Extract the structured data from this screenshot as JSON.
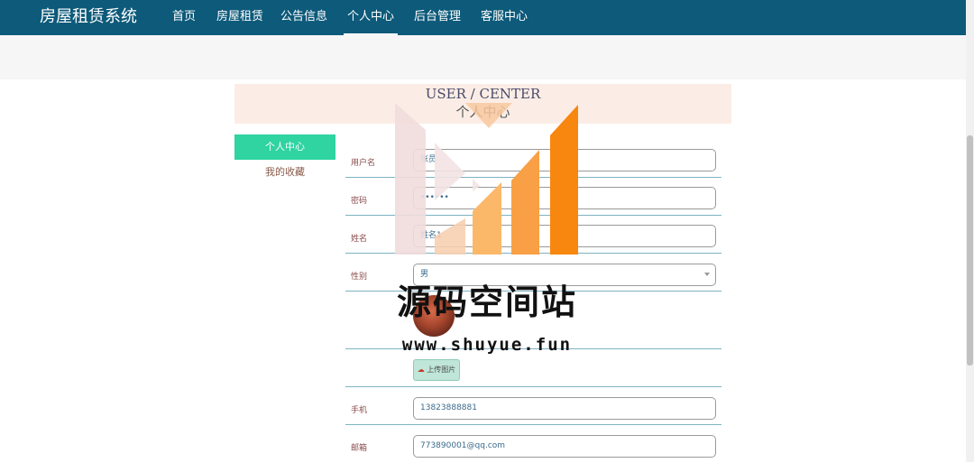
{
  "nav": {
    "brand": "房屋租赁系统",
    "items": [
      {
        "label": "首页"
      },
      {
        "label": "房屋租赁"
      },
      {
        "label": "公告信息"
      },
      {
        "label": "个人中心"
      },
      {
        "label": "后台管理"
      },
      {
        "label": "客服中心"
      }
    ],
    "active_index": 3
  },
  "section": {
    "title_en": "USER / CENTER",
    "title_cn": "个人中心"
  },
  "sidebar": {
    "items": [
      {
        "label": "个人中心",
        "active": true
      },
      {
        "label": "我的收藏",
        "active": false
      }
    ]
  },
  "form": {
    "username": {
      "label": "用户名",
      "value": "张员"
    },
    "password": {
      "label": "密码",
      "value": "••••••"
    },
    "name": {
      "label": "姓名",
      "value": "姓名1"
    },
    "gender": {
      "label": "性别",
      "value": "男"
    },
    "upload_label": "上传图片",
    "phone": {
      "label": "手机",
      "value": "13823888881"
    },
    "email": {
      "label": "邮箱",
      "value": "773890001@qq.com"
    }
  },
  "watermark": {
    "text": "源码空间站",
    "url": "www.shuyue.fun"
  },
  "colors": {
    "nav_bg": "#0d5a7a",
    "accent": "#2fd4a0",
    "header_bg": "#fbede5",
    "logo_orange": "#f7870f"
  },
  "icons": {
    "upload": "cloud-upload-icon",
    "select": "chevron-down-icon"
  }
}
